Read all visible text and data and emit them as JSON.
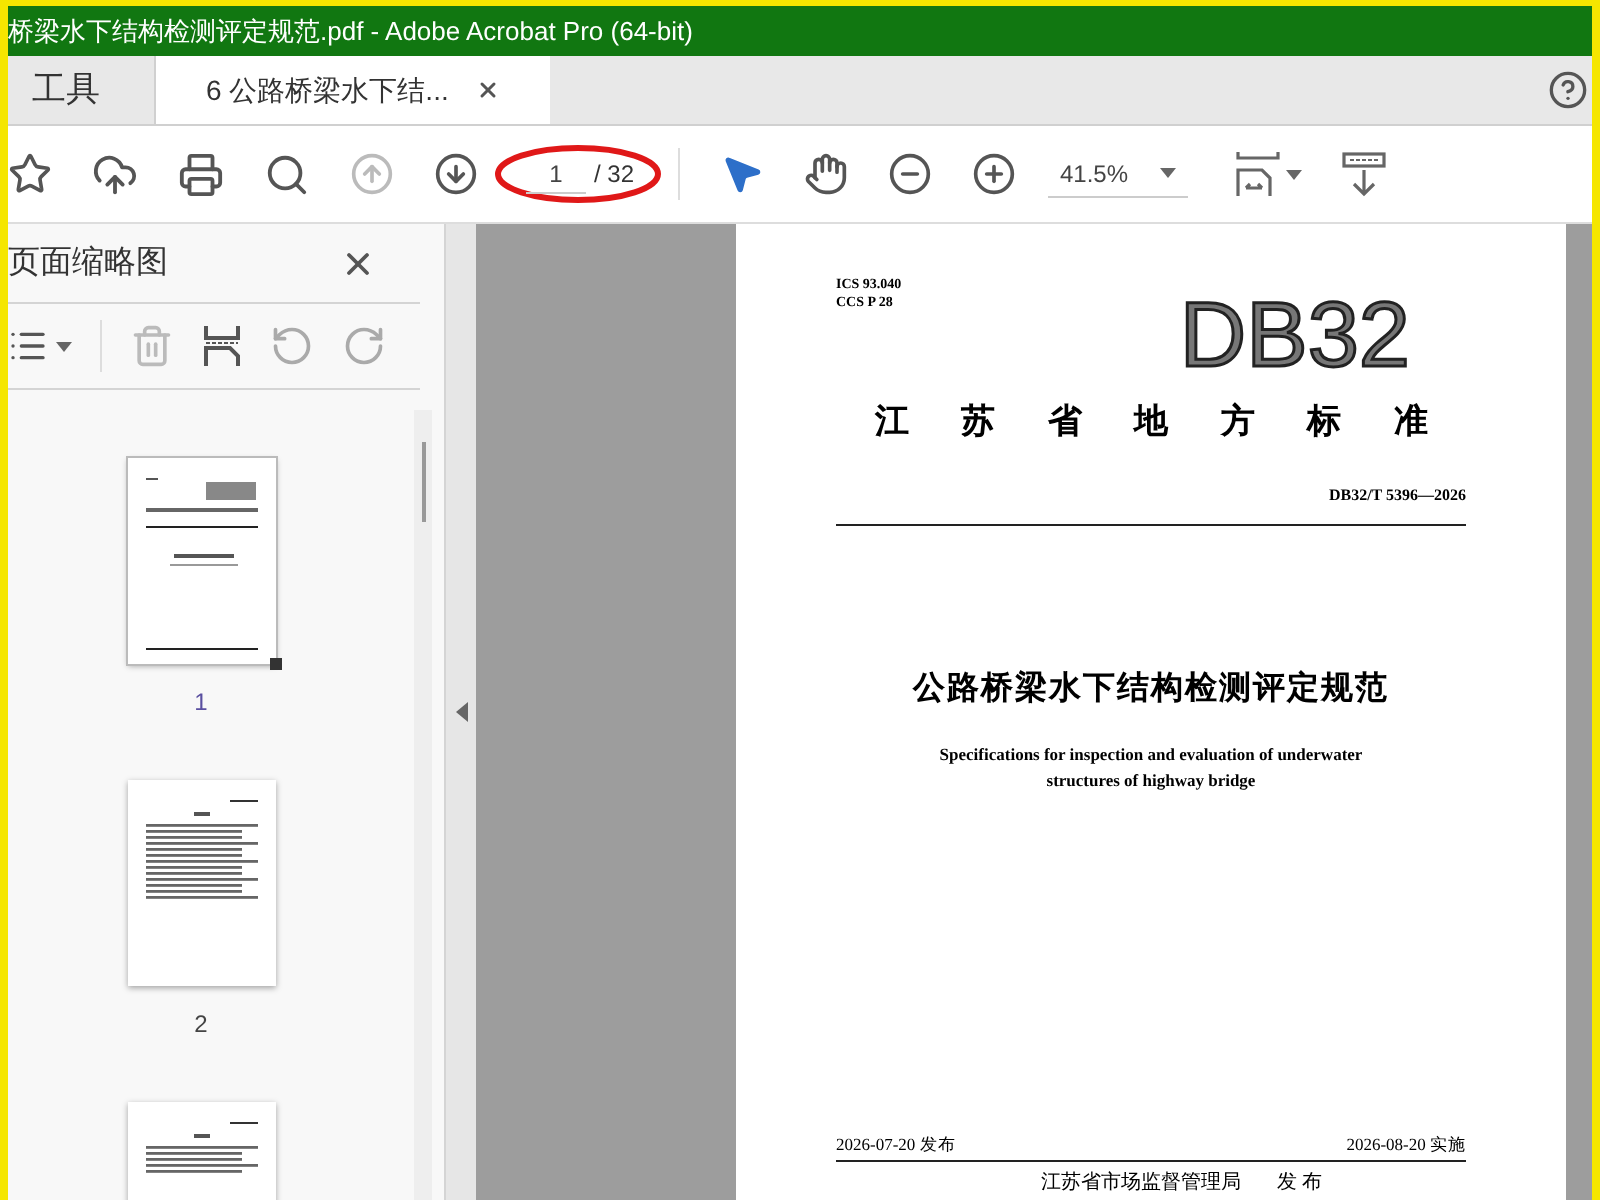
{
  "window": {
    "title": "桥梁水下结构检测评定规范.pdf - Adobe Acrobat Pro (64-bit)"
  },
  "tabs": [
    {
      "label": "工具",
      "selected": false,
      "closable": false
    },
    {
      "label": "6 公路桥梁水下结...",
      "selected": true,
      "closable": true
    }
  ],
  "toolbar": {
    "page_input": "1",
    "page_total": "/ 32",
    "zoom": "41.5%"
  },
  "sidebar": {
    "title": "页面缩略图",
    "thumbnails": [
      {
        "label": "1",
        "selected": true,
        "kind": "cover"
      },
      {
        "label": "2",
        "selected": false,
        "kind": "contents"
      },
      {
        "kind": "text",
        "selected": false
      }
    ]
  },
  "document": {
    "ics": "ICS 93.040",
    "ccs": "CCS P 28",
    "logo": "DB32",
    "standard_type": "江 苏 省 地 方 标 准",
    "code": "DB32/T 5396—2026",
    "title": "公路桥梁水下结构检测评定规范",
    "subtitle": "Specifications for inspection and evaluation of underwater structures of highway bridge",
    "issue_date": "2026-07-20 发布",
    "effective_date": "2026-08-20 实施",
    "publisher": "江苏省市场监督管理局",
    "publish_word": "发 布"
  }
}
